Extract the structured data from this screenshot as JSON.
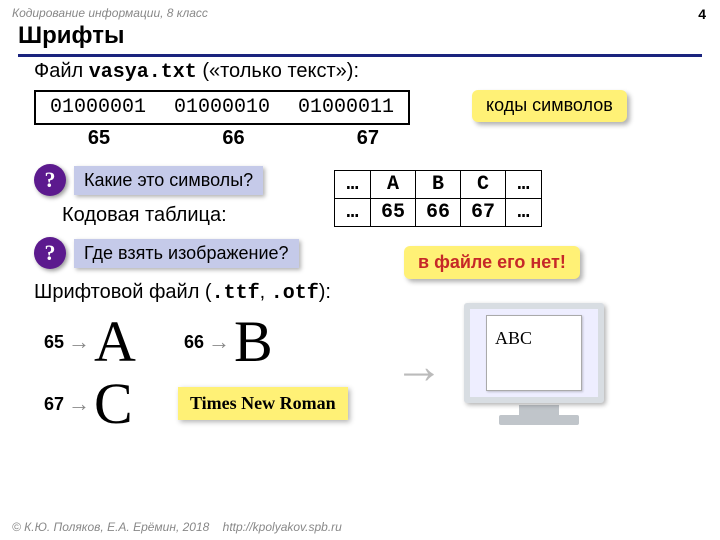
{
  "meta": {
    "subject": "Кодирование информации, 8 класс",
    "page": "4",
    "title": "Шрифты",
    "footer_left": "© К.Ю. Поляков, Е.А. Ерёмин, 2018",
    "footer_url": "http://kpolyakov.spb.ru"
  },
  "file_line": {
    "prefix": "Файл ",
    "filename": "vasya.txt",
    "suffix": " («только текст»):"
  },
  "binary": [
    "01000001",
    "01000010",
    "01000011"
  ],
  "decimals": [
    "65",
    "66",
    "67"
  ],
  "badge_codes": "коды символов",
  "question1": "Какие это символы?",
  "codetable_label": "Кодовая таблица:",
  "code_table": {
    "row1": [
      "…",
      "A",
      "B",
      "C",
      "…"
    ],
    "row2": [
      "…",
      "65",
      "66",
      "67",
      "…"
    ]
  },
  "question2": "Где взять изображение?",
  "badge_nofile": "в файле его нет!",
  "fontfile_line": {
    "prefix": "Шрифтовой файл (",
    "ext1": ".ttf",
    "mid": ", ",
    "ext2": ".otf",
    "suffix": "):"
  },
  "glyphs": [
    {
      "code": "65",
      "glyph": "A"
    },
    {
      "code": "66",
      "glyph": "B"
    },
    {
      "code": "67",
      "glyph": "C"
    }
  ],
  "font_name": "Times New Roman",
  "monitor_text": "ABC",
  "qmark": "?",
  "arrow": "→"
}
